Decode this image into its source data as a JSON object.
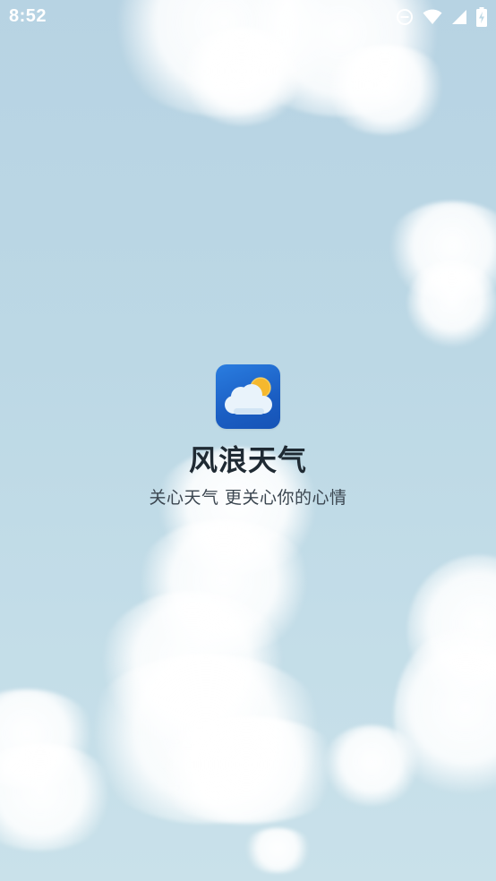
{
  "status_bar": {
    "time": "8:52",
    "icons": [
      "do-not-disturb-icon",
      "wifi-icon",
      "cellular-signal-icon",
      "battery-charging-icon"
    ]
  },
  "splash": {
    "app_icon": "cloud-sun-icon",
    "title": "风浪天气",
    "slogan": "关心天气 更关心你的心情"
  },
  "colors": {
    "sky": "#bcd8e5",
    "icon_blue": "#1b5ec3",
    "sun": "#f5b82e",
    "title_text": "#1f2a33",
    "slogan_text": "#3b4650"
  }
}
